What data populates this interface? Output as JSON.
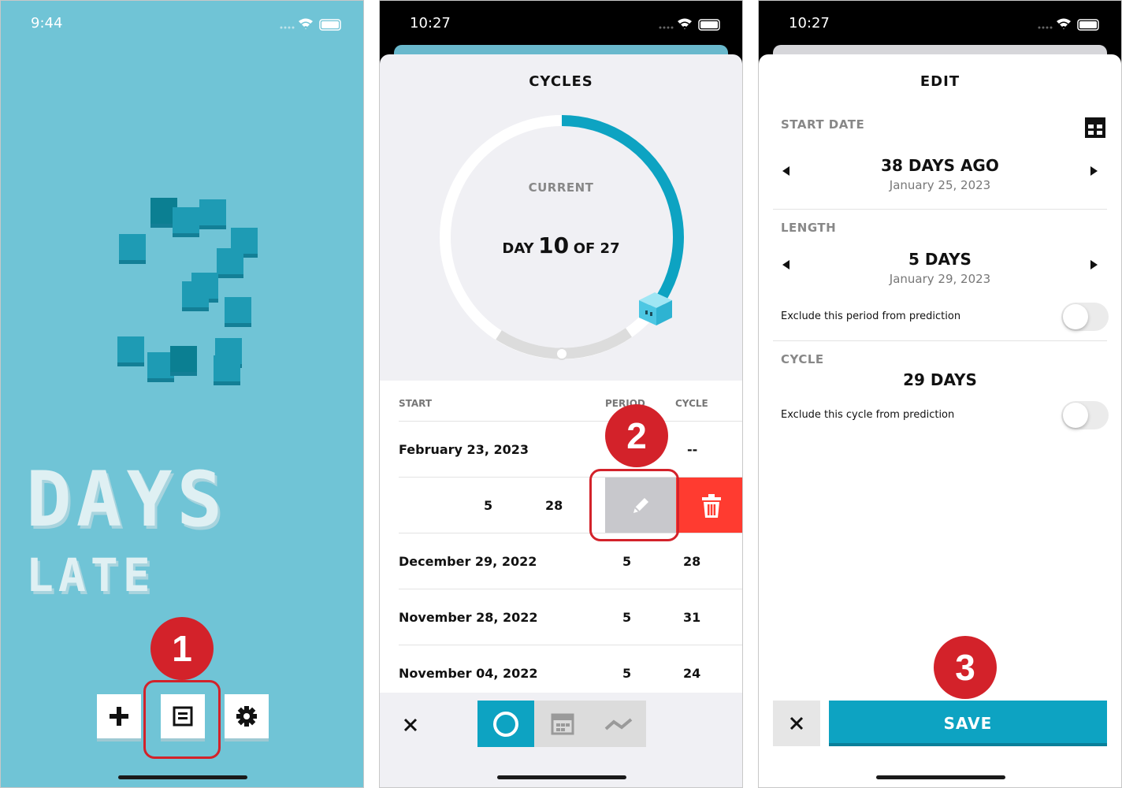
{
  "screen1": {
    "time": "9:44",
    "days_text": "DAYS",
    "late_text": "LATE",
    "toolbar": {
      "add_icon": "plus-icon",
      "list_icon": "list-icon",
      "settings_icon": "gear-icon"
    },
    "step_marker": "1"
  },
  "screen2": {
    "time": "10:27",
    "title": "CYCLES",
    "ring": {
      "current_label": "CURRENT",
      "day_word": "DAY",
      "day_number": "10",
      "of_text": "OF 27",
      "progress": 0.37
    },
    "table": {
      "headers": {
        "start": "START",
        "period": "PERIOD",
        "cycle": "CYCLE"
      },
      "rows": [
        {
          "start": "February 23, 2023",
          "period": "",
          "cycle": "--"
        },
        {
          "start": "",
          "period": "5",
          "cycle": "28"
        },
        {
          "start": "December 29, 2022",
          "period": "5",
          "cycle": "28"
        },
        {
          "start": "November 28, 2022",
          "period": "5",
          "cycle": "31"
        },
        {
          "start": "November 04, 2022",
          "period": "5",
          "cycle": "24"
        }
      ]
    },
    "step_marker": "2",
    "colors": {
      "accent": "#0da3c2",
      "delete": "#ff3b30",
      "edit": "#c8c8cc"
    }
  },
  "screen3": {
    "time": "10:27",
    "title": "EDIT",
    "start_date": {
      "label": "START DATE",
      "value": "38 DAYS AGO",
      "date": "January 25, 2023"
    },
    "length": {
      "label": "LENGTH",
      "value": "5 DAYS",
      "date": "January 29, 2023",
      "exclude_label": "Exclude this period from prediction"
    },
    "cycle": {
      "label": "CYCLE",
      "value": "29 DAYS",
      "exclude_label": "Exclude this cycle from prediction"
    },
    "save_label": "SAVE",
    "step_marker": "3"
  }
}
